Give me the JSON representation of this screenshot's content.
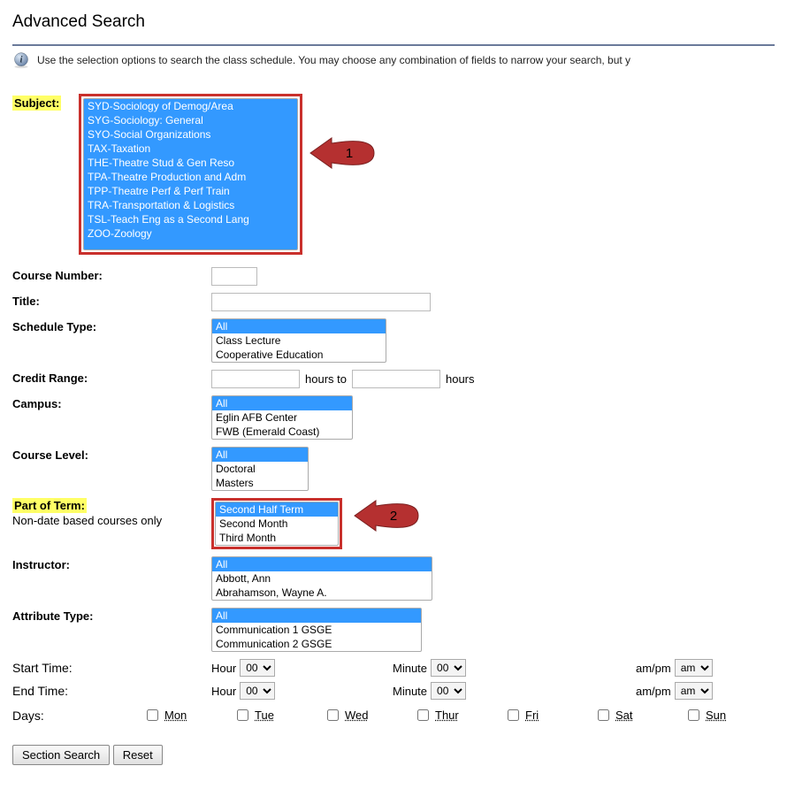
{
  "page_title": "Advanced Search",
  "info_text": "Use the selection options to search the class schedule. You may choose any combination of fields to narrow your search, but y",
  "labels": {
    "subject": "Subject:",
    "course_number": "Course Number:",
    "title": "Title:",
    "schedule_type": "Schedule Type:",
    "credit_range": "Credit Range:",
    "campus": "Campus:",
    "course_level": "Course Level:",
    "part_of_term": "Part of Term:",
    "part_of_term_note": "Non-date based courses only",
    "instructor": "Instructor:",
    "attribute_type": "Attribute Type:",
    "start_time": "Start Time:",
    "end_time": "End Time:",
    "days": "Days:",
    "hour": "Hour",
    "minute": "Minute",
    "ampm": "am/pm",
    "hours_to": "hours to",
    "hours_suffix": "hours"
  },
  "subject_options": [
    "SYD-Sociology of Demog/Area",
    "SYG-Sociology: General",
    "SYO-Social Organizations",
    "TAX-Taxation",
    "THE-Theatre Stud & Gen Reso",
    "TPA-Theatre Production and Adm",
    "TPP-Theatre Perf & Perf Train",
    "TRA-Transportation & Logistics",
    "TSL-Teach Eng as a Second Lang",
    "ZOO-Zoology"
  ],
  "schedule_type_options": [
    "All",
    "Class Lecture",
    "Cooperative Education"
  ],
  "schedule_type_selected": "All",
  "campus_options": [
    "All",
    "Eglin AFB Center",
    "FWB (Emerald Coast)"
  ],
  "campus_selected": "All",
  "course_level_options": [
    "All",
    "Doctoral",
    "Masters"
  ],
  "course_level_selected": "All",
  "part_of_term_options": [
    "Second Half Term",
    "Second Month",
    "Third Month"
  ],
  "part_of_term_selected": "Second Half Term",
  "instructor_options": [
    "All",
    "Abbott, Ann",
    "Abrahamson, Wayne A."
  ],
  "instructor_selected": "All",
  "attribute_type_options": [
    "All",
    "Communication 1 GSGE",
    "Communication 2 GSGE"
  ],
  "attribute_type_selected": "All",
  "hour_options": [
    "00"
  ],
  "minute_options": [
    "00"
  ],
  "ampm_options": [
    "am"
  ],
  "hour_value": "00",
  "minute_value": "00",
  "ampm_value": "am",
  "days_list": [
    "Mon",
    "Tue",
    "Wed",
    "Thur",
    "Fri",
    "Sat",
    "Sun"
  ],
  "buttons": {
    "search": "Section Search",
    "reset": "Reset"
  },
  "callouts": {
    "one": "1",
    "two": "2"
  }
}
